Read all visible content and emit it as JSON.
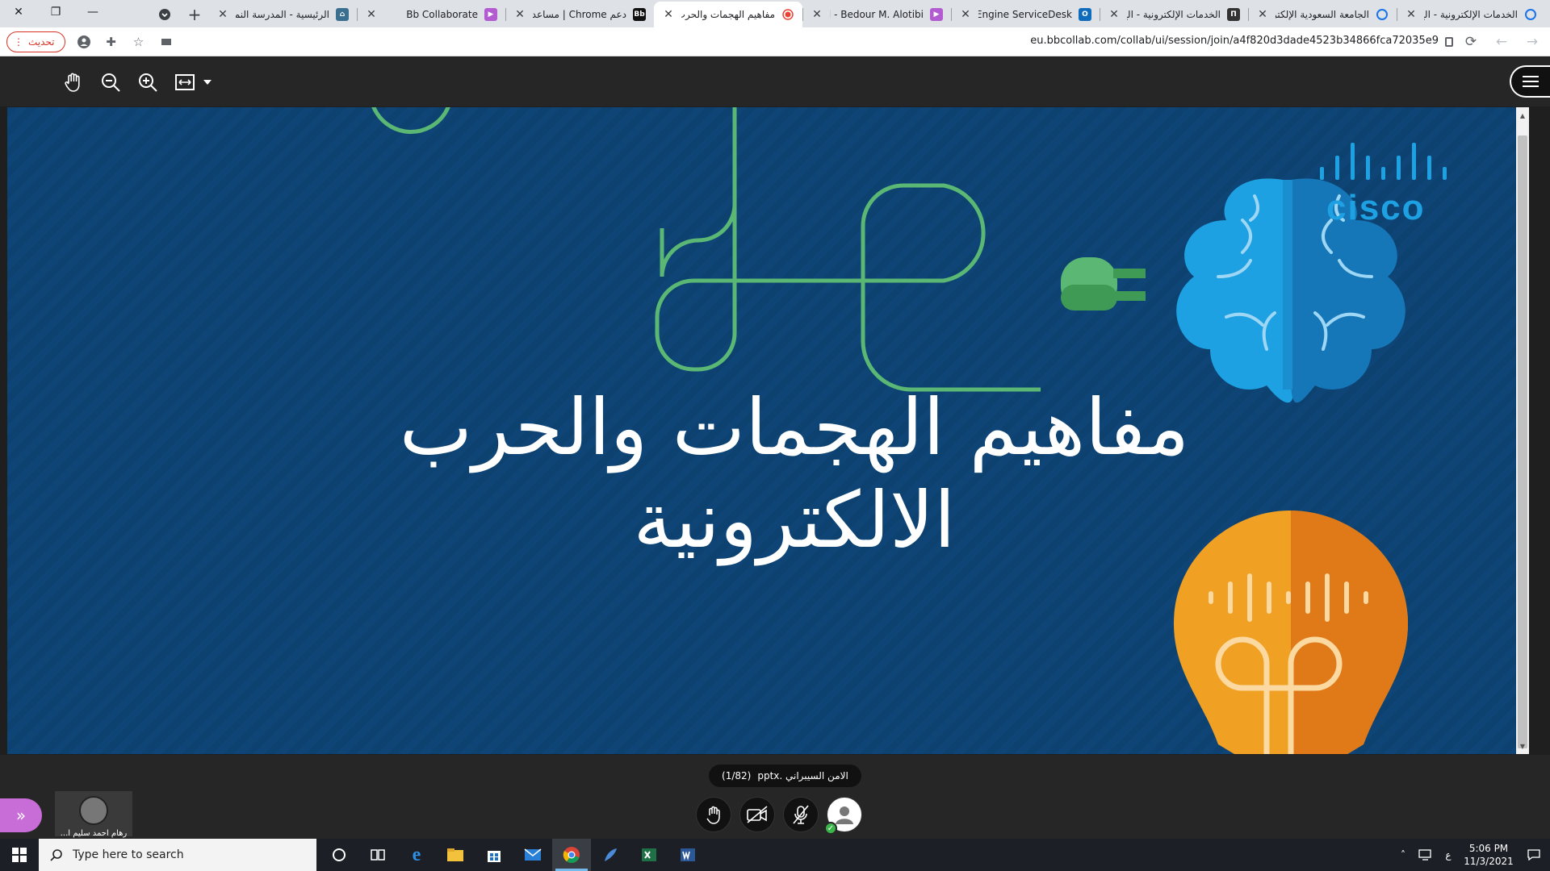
{
  "browser": {
    "tabs": [
      {
        "title": "الخدمات الإلكترونية - الج",
        "favicon": "globe-icon",
        "color": "#1a73e8",
        "active": false
      },
      {
        "title": "الجامعة السعودية الإلكترونية",
        "favicon": "globe-icon",
        "color": "#1a73e8",
        "active": false
      },
      {
        "title": "الخدمات الإلكترونية - الج",
        "favicon": "app-icon",
        "color": "#333333",
        "active": false
      },
      {
        "title": "ManageEngine ServiceDesk",
        "favicon": "outlook-icon",
        "color": "#0f6cbd",
        "active": false
      },
      {
        "title": "Mail - Bedour M. Alotibi",
        "favicon": "collaborate-icon",
        "color": "#b35bd1",
        "active": false
      },
      {
        "title": "مفاهيم الهجمات والحرب",
        "favicon": "recording-icon",
        "color": "#ea4335",
        "active": true
      },
      {
        "title": "دعم Chrome | مساعدة",
        "favicon": "blackboard-icon",
        "color": "#111111",
        "active": false
      },
      {
        "title": "Bb Collaborate",
        "favicon": "collaborate-icon",
        "color": "#b35bd1",
        "active": false
      },
      {
        "title": "الرئيسية - المدرسة النموذجية",
        "favicon": "school-icon",
        "color": "#3b6f8f",
        "active": false
      }
    ],
    "url": "eu.bbcollab.com/collab/ui/session/join/a4f820d3dade4523b34866fca72035e9",
    "update_label": "تحديث"
  },
  "slide": {
    "title": "مفاهيم الهجمات والحرب الالكترونية",
    "brand": "cisco"
  },
  "session": {
    "file_name": "الامن السيبراني .pptx",
    "page_counter": "(1/82)",
    "participant_name": "رهام احمد سليم ا..."
  },
  "taskbar": {
    "search_placeholder": "Type here to search",
    "time": "5:06 PM",
    "date": "11/3/2021",
    "lang": "ع"
  },
  "colors": {
    "slide_bg": "#0d4270",
    "green": "#5bb874",
    "brain_blue": "#1da1e2",
    "bulb_orange": "#f0a023",
    "collab_purple": "#c86dd7"
  }
}
